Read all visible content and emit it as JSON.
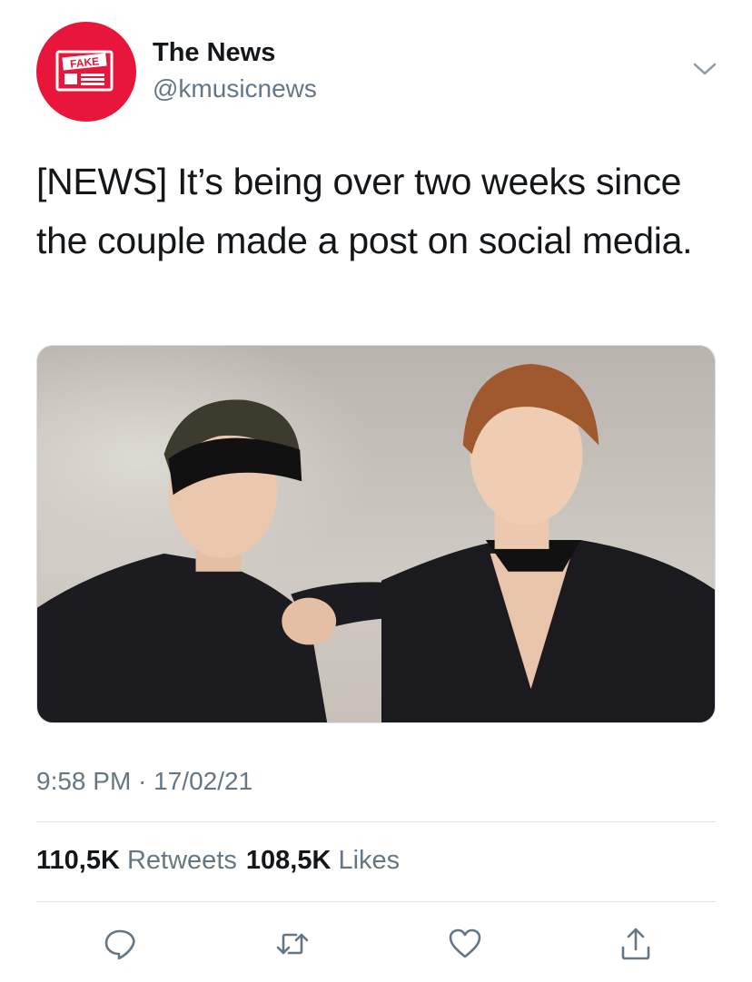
{
  "account": {
    "name": "The News",
    "handle": "@kmusicnews",
    "avatar_icon": "fake-newspaper-icon",
    "avatar_badge_text": "FAKE",
    "avatar_color": "#e8163a"
  },
  "tweet": {
    "text": "[NEWS] It’s being over two weeks since the couple made a post on social media.",
    "media_icon": "photo-two-people",
    "timestamp": "9:58 PM · 17/02/21"
  },
  "stats": {
    "retweets_count": "110,5K",
    "retweets_label": "Retweets",
    "likes_count": "108,5K",
    "likes_label": "Likes"
  },
  "actions": [
    {
      "name": "reply",
      "icon": "reply-icon"
    },
    {
      "name": "retweet",
      "icon": "retweet-icon"
    },
    {
      "name": "like",
      "icon": "heart-icon"
    },
    {
      "name": "share",
      "icon": "share-icon"
    }
  ],
  "colors": {
    "secondary_text": "#657786",
    "primary_text": "#14171a",
    "icon": "#657786"
  }
}
